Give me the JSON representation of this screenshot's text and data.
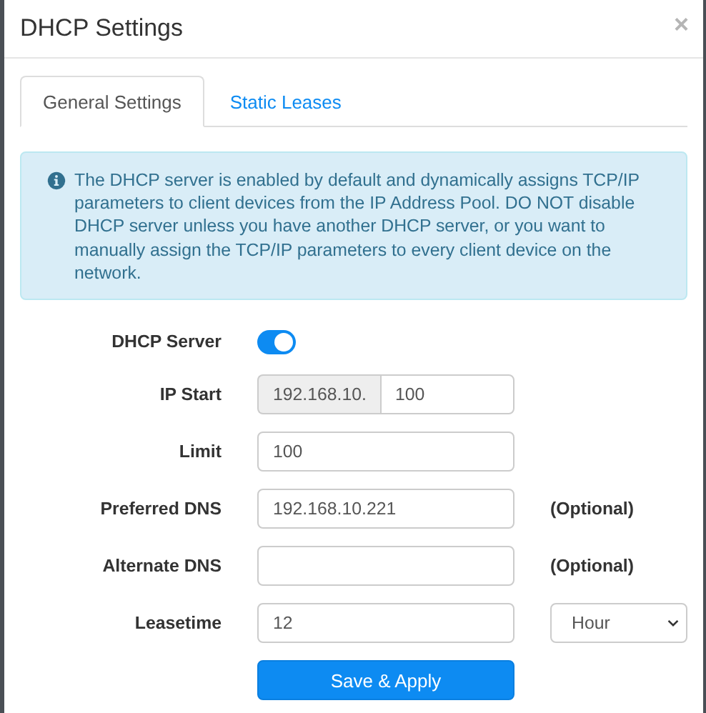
{
  "dialog": {
    "title": "DHCP Settings",
    "close": "×"
  },
  "tabs": [
    {
      "label": "General Settings",
      "selected": true
    },
    {
      "label": "Static Leases",
      "selected": false
    }
  ],
  "alert": {
    "text": "The DHCP server is enabled by default and dynamically assigns TCP/IP parameters to client devices from the IP Address Pool. DO NOT disable DHCP server unless you have another DHCP server, or you want to manually assign the TCP/IP parameters to every client device on the network."
  },
  "fields": [
    {
      "kind": "toggle",
      "label": "DHCP Server",
      "on": true
    },
    {
      "kind": "prefixed",
      "label": "IP Start",
      "prefix": "192.168.10.",
      "value": "100"
    },
    {
      "kind": "text",
      "label": "Limit",
      "value": "100"
    },
    {
      "kind": "text",
      "label": "Preferred DNS",
      "value": "192.168.10.221",
      "note": "(Optional)"
    },
    {
      "kind": "text",
      "label": "Alternate DNS",
      "note": "(Optional)"
    },
    {
      "kind": "select",
      "label": "Leasetime",
      "value": "12",
      "unit": "Hour"
    }
  ],
  "submit": "Save & Apply"
}
